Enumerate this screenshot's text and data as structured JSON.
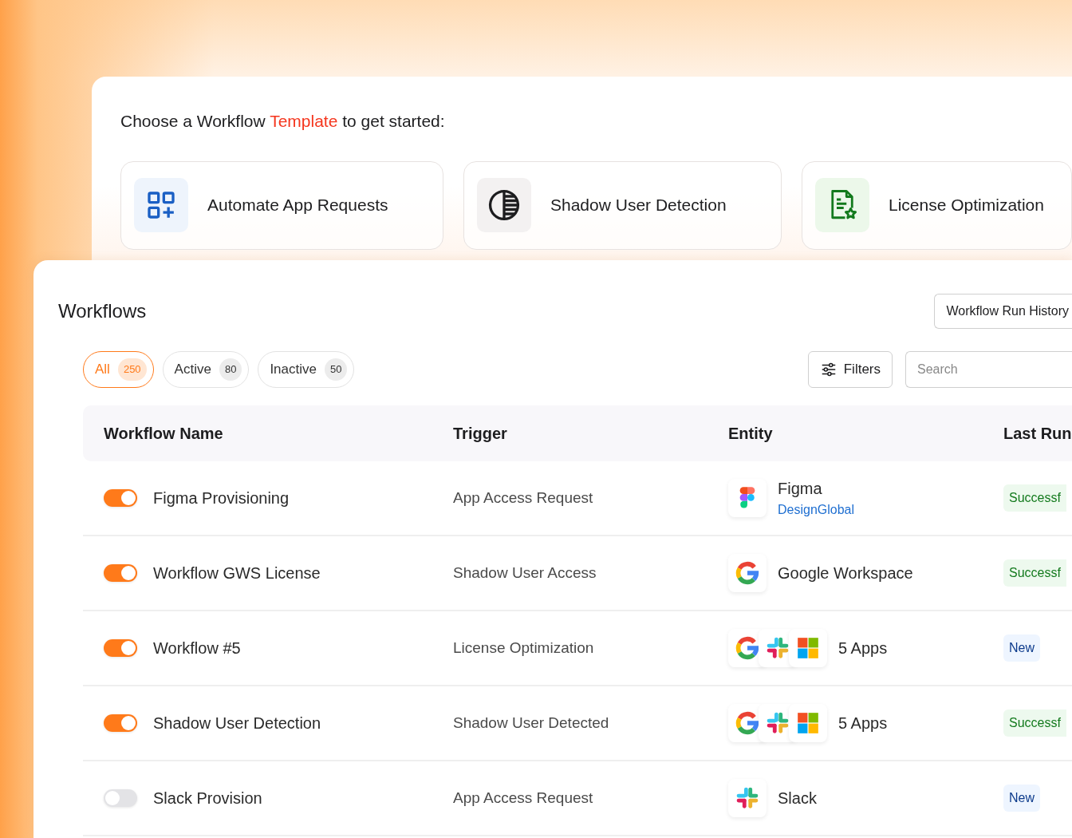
{
  "templates_panel": {
    "heading": {
      "before": "Choose a Workflow ",
      "highlight": "Template",
      "after": " to get started:"
    },
    "templates": [
      {
        "label": "Automate App Requests",
        "kind": "apps"
      },
      {
        "label": "Shadow User Detection",
        "kind": "shadow"
      },
      {
        "label": "License Optimization",
        "kind": "license"
      }
    ]
  },
  "workflows": {
    "title": "Workflows",
    "history_button": "Workflow Run History",
    "filter_tabs": [
      {
        "label": "All",
        "count": "250",
        "selected": true
      },
      {
        "label": "Active",
        "count": "80",
        "selected": false
      },
      {
        "label": "Inactive",
        "count": "50",
        "selected": false
      }
    ],
    "filters_button": "Filters",
    "search": {
      "placeholder": "Search"
    },
    "table": {
      "columns": [
        "Workflow Name",
        "Trigger",
        "Entity",
        "Last Run"
      ],
      "rows": [
        {
          "enabled": true,
          "name": "Figma Provisioning",
          "trigger": "App Access Request",
          "entity": {
            "icons": [
              {
                "kind": "figma"
              }
            ],
            "name": "Figma",
            "subtitle": "DesignGlobal"
          },
          "status": {
            "label": "Successf",
            "kind": "success"
          }
        },
        {
          "enabled": true,
          "name": "Workflow GWS License",
          "trigger": "Shadow User Access",
          "entity": {
            "icons": [
              {
                "kind": "google"
              }
            ],
            "name": "Google Workspace"
          },
          "status": {
            "label": "Successf",
            "kind": "success"
          }
        },
        {
          "enabled": true,
          "name": "Workflow #5",
          "trigger": "License Optimization",
          "entity": {
            "icons": [
              {
                "kind": "google"
              },
              {
                "kind": "slack"
              },
              {
                "kind": "microsoft"
              }
            ],
            "name": "5 Apps"
          },
          "status": {
            "label": "New",
            "kind": "new"
          }
        },
        {
          "enabled": true,
          "name": "Shadow User Detection",
          "trigger": "Shadow User Detected",
          "entity": {
            "icons": [
              {
                "kind": "google"
              },
              {
                "kind": "slack"
              },
              {
                "kind": "microsoft"
              }
            ],
            "name": "5 Apps"
          },
          "status": {
            "label": "Successf",
            "kind": "success"
          }
        },
        {
          "enabled": false,
          "name": "Slack Provision",
          "trigger": "App Access Request",
          "entity": {
            "icons": [
              {
                "kind": "slack"
              }
            ],
            "name": "Slack"
          },
          "status": {
            "label": "New",
            "kind": "new"
          }
        }
      ]
    }
  }
}
